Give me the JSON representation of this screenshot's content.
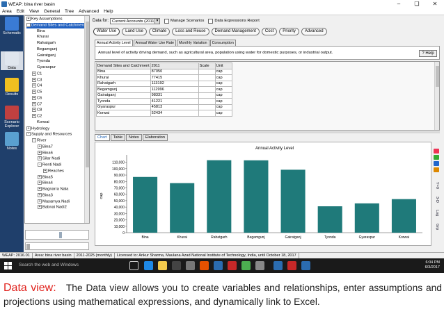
{
  "window": {
    "title": "WEAP: bina river basin"
  },
  "menu": [
    "Area",
    "Edit",
    "View",
    "General",
    "Tree",
    "Advanced",
    "Help"
  ],
  "views": [
    {
      "label": "Schematic",
      "icon": "schematic-icon"
    },
    {
      "label": "Data",
      "icon": "data-icon"
    },
    {
      "label": "Results",
      "icon": "results-icon"
    },
    {
      "label": "Scenario Explorer",
      "icon": "scenario-explorer-icon"
    },
    {
      "label": "Notes",
      "icon": "notes-icon"
    }
  ],
  "tree": [
    {
      "label": "Key Assumptions",
      "level": 0,
      "exp": "+"
    },
    {
      "label": "Demand Sites and Catchments",
      "level": 0,
      "exp": "-",
      "selected": true
    },
    {
      "label": "Bina",
      "level": 1
    },
    {
      "label": "Khurai",
      "level": 1
    },
    {
      "label": "Rahatgarh",
      "level": 1
    },
    {
      "label": "Begamgunj",
      "level": 1
    },
    {
      "label": "Gairatganj",
      "level": 1
    },
    {
      "label": "Tyonda",
      "level": 1
    },
    {
      "label": "Gyaraspur",
      "level": 1
    },
    {
      "label": "C1",
      "level": 1,
      "exp": "+"
    },
    {
      "label": "C3",
      "level": 1,
      "exp": "+"
    },
    {
      "label": "C4",
      "level": 1,
      "exp": "+"
    },
    {
      "label": "C5",
      "level": 1,
      "exp": "+"
    },
    {
      "label": "C6",
      "level": 1,
      "exp": "+"
    },
    {
      "label": "C7",
      "level": 1,
      "exp": "+"
    },
    {
      "label": "C8",
      "level": 1,
      "exp": "+"
    },
    {
      "label": "C2",
      "level": 1,
      "exp": "+"
    },
    {
      "label": "Korwai",
      "level": 1
    },
    {
      "label": "Hydrology",
      "level": 0,
      "exp": "+"
    },
    {
      "label": "Supply and Resources",
      "level": 0,
      "exp": "-"
    },
    {
      "label": "River",
      "level": 1,
      "exp": "-"
    },
    {
      "label": "Bina7",
      "level": 2,
      "exp": "+"
    },
    {
      "label": "Bina6",
      "level": 2,
      "exp": "+"
    },
    {
      "label": "Silar Nadi",
      "level": 2,
      "exp": "+"
    },
    {
      "label": "Renti Nadi",
      "level": 2,
      "exp": "-"
    },
    {
      "label": "Reaches",
      "level": 3,
      "exp": "+"
    },
    {
      "label": "Bina5",
      "level": 2,
      "exp": "+"
    },
    {
      "label": "Bina4",
      "level": 2,
      "exp": "+"
    },
    {
      "label": "Bagnarra Nala",
      "level": 2,
      "exp": "+"
    },
    {
      "label": "Bina3",
      "level": 2,
      "exp": "+"
    },
    {
      "label": "Masarnya Nadi",
      "level": 2,
      "exp": "+"
    },
    {
      "label": "Babnai Nadi2",
      "level": 2,
      "exp": "+"
    }
  ],
  "toolbar": {
    "data_for_label": "Data for:",
    "data_for_value": "Current Accounts (2011)",
    "manage_scenarios": "Manage Scenarios",
    "data_expressions_report": "Data Expressions Report"
  },
  "pills": [
    "Water Use",
    "Land Use",
    "Climate",
    "Loss and Reuse",
    "Demand Management",
    "Cost",
    "Priority",
    "Advanced"
  ],
  "subtabs": [
    "Annual Activity Level",
    "Annual Water Use Rate",
    "Monthly Variation",
    "Consumption"
  ],
  "description": "Annual level of activity driving demand, such as agricultural area, population using water for domestic purposes, or industrial output.",
  "help_label": "Help",
  "table": {
    "headers": [
      "Demand Sites and Catchment",
      "2011",
      "Scale",
      "Unit"
    ],
    "rows": [
      [
        "Bina",
        "87050",
        "",
        "cap"
      ],
      [
        "Khurai",
        "77415",
        "",
        "cap"
      ],
      [
        "Rahatgarh",
        "113192",
        "",
        "cap"
      ],
      [
        "Begamgunj",
        "112996",
        "",
        "cap"
      ],
      [
        "Gairatganj",
        "98331",
        "",
        "cap"
      ],
      [
        "Tyonda",
        "41221",
        "",
        "cap"
      ],
      [
        "Gyaraspur",
        "45813",
        "",
        "cap"
      ],
      [
        "Korwai",
        "52434",
        "",
        "cap"
      ]
    ]
  },
  "chart_tabs": [
    "Chart",
    "Table",
    "Notes",
    "Elaboration"
  ],
  "chart_data": {
    "type": "bar",
    "title": "Annual Activity Level",
    "ylabel": "cap",
    "xlabel": "",
    "categories": [
      "Bina",
      "Khurai",
      "Rahatgarh",
      "Begamgunj",
      "Gairatganj",
      "Tyonda",
      "Gyaraspur",
      "Korwai"
    ],
    "values": [
      87050,
      77415,
      113192,
      112996,
      98331,
      41221,
      45813,
      52434
    ],
    "ylim": [
      0,
      115000
    ],
    "yticks": [
      0,
      10000,
      20000,
      30000,
      40000,
      50000,
      60000,
      70000,
      80000,
      90000,
      100000,
      110000
    ],
    "ytick_labels": [
      "0",
      "10,000",
      "20,000",
      "30,000",
      "40,000",
      "50,000",
      "60,000",
      "70,000",
      "80,000",
      "90,000",
      "100,000",
      "110,000"
    ],
    "bar_color": "#1f7a7a",
    "grid": false,
    "legend": "none"
  },
  "side_tools": [
    "Y=0",
    "3-D",
    "Log",
    "Grp"
  ],
  "status": [
    "WEAP: 2016.01",
    "Area: bina river basin",
    "2011-2025 (monthly)",
    "Licensed to: Ankur Sharma, Maulana Azad National Institute of Technology, India, until October 18, 2017"
  ],
  "taskbar": {
    "search_placeholder": "Search the web and Windows",
    "time": "6:04 PM",
    "date": "6/3/2017"
  },
  "caption": {
    "lead": "Data view:",
    "text": "The Data view allows you to create variables and relationships, enter assumptions and projections using mathematical expressions, and dynamically link to Excel."
  }
}
